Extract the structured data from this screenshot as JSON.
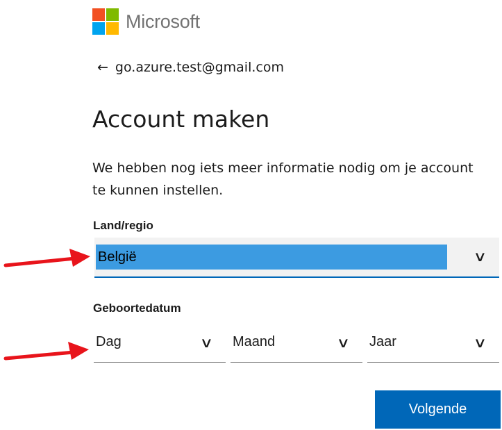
{
  "brand": {
    "name": "Microsoft",
    "logo_colors": [
      "#f25022",
      "#7fba00",
      "#00a4ef",
      "#ffb900"
    ]
  },
  "back": {
    "arrow": "←",
    "email": "go.azure.test@gmail.com"
  },
  "page_title": "Account maken",
  "description": "We hebben nog iets meer informatie nodig om je account te kunnen instellen.",
  "country": {
    "label": "Land/regio",
    "selected": "België"
  },
  "birthdate": {
    "label": "Geboortedatum",
    "day_label": "Dag",
    "month_label": "Maand",
    "year_label": "Jaar"
  },
  "next_button": "Volgende",
  "colors": {
    "primary": "#0067b8",
    "selection_highlight": "#3c9be1",
    "annotation_arrow": "#e8141b"
  }
}
